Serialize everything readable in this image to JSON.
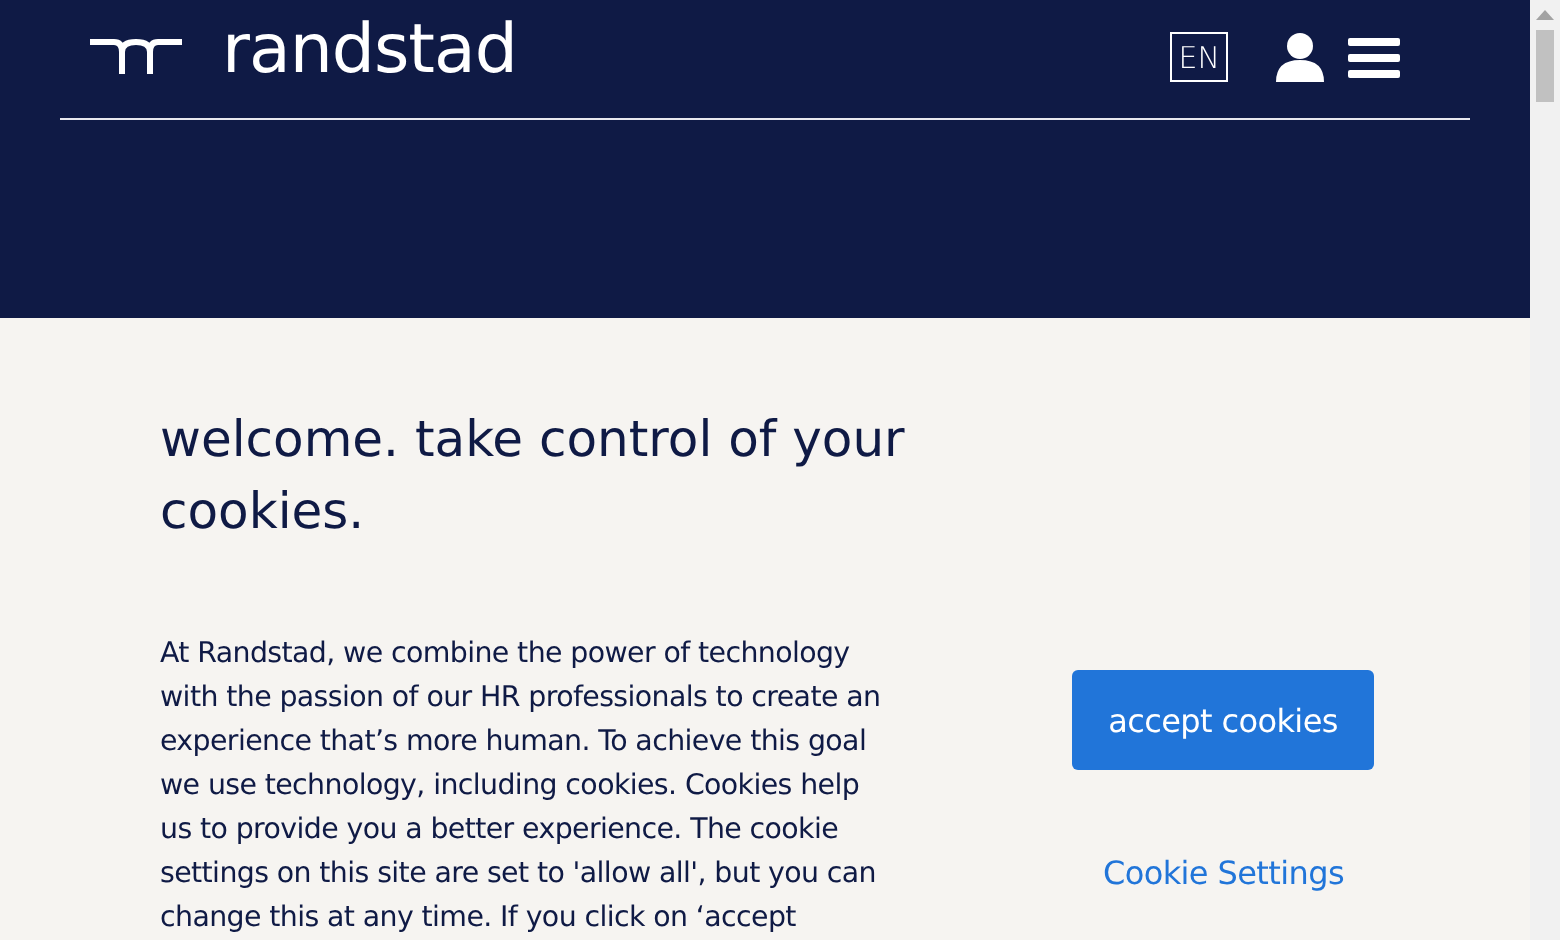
{
  "header": {
    "logo_text": "randstad",
    "language": "EN"
  },
  "banner": {
    "title": "welcome. take control of your cookies.",
    "body_lines": [
      "At Randstad, we combine the power of technology",
      "with the passion of our HR professionals to create an",
      "experience that’s more human. To achieve this goal",
      "we use technology, including cookies. Cookies help",
      "us to provide you a better experience. The cookie",
      "settings on this site are set to 'allow all', but you can",
      "change this at any time. If you click on ‘accept"
    ],
    "accept_button": "accept cookies",
    "settings_link": "Cookie Settings"
  }
}
